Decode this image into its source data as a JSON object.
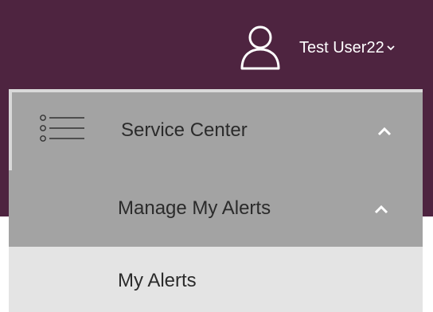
{
  "header": {
    "user_name": "Test User22",
    "user_icon": "user-icon",
    "caret_icon": "chevron-down-icon",
    "background": "#4e2440"
  },
  "menu": {
    "service_center": {
      "label": "Service Center",
      "icon": "list-icon",
      "expand_icon": "chevron-up-icon"
    },
    "manage_alerts": {
      "label": "Manage My Alerts",
      "expand_icon": "chevron-up-icon"
    },
    "my_alerts": {
      "label": "My Alerts"
    },
    "colors": {
      "active_row": "#a3a3a3",
      "sub_row": "#e4e4e4"
    }
  }
}
